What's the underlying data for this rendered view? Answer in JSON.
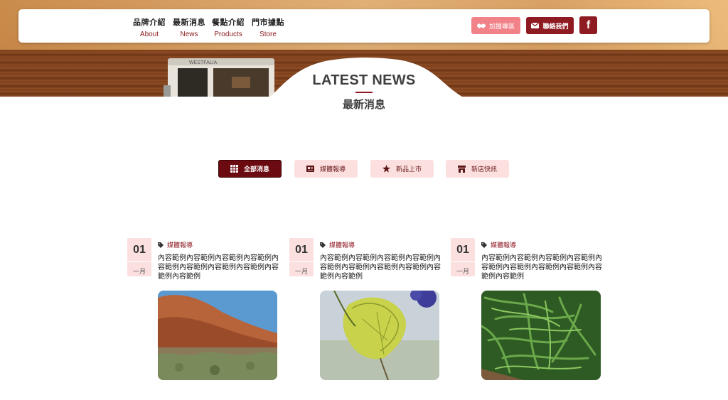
{
  "nav": {
    "items": [
      {
        "zh": "品牌介紹",
        "en": "About"
      },
      {
        "zh": "最新消息",
        "en": "News"
      },
      {
        "zh": "餐點介紹",
        "en": "Products"
      },
      {
        "zh": "門市據點",
        "en": "Store"
      }
    ],
    "join_label": "加盟專區",
    "contact_label": "聯絡我們",
    "facebook_label": "f"
  },
  "section": {
    "title_en": "LATEST NEWS",
    "title_zh": "最新消息"
  },
  "tabs": [
    {
      "label": "全部消息",
      "icon": "grid-icon",
      "active": true
    },
    {
      "label": "媒體報導",
      "icon": "newspaper-icon",
      "active": false
    },
    {
      "label": "新品上市",
      "icon": "star-icon",
      "active": false
    },
    {
      "label": "新店快訊",
      "icon": "store-icon",
      "active": false
    }
  ],
  "cards": [
    {
      "day": "01",
      "month": "一月",
      "category": "媒體報導",
      "text": "內容範例內容範例內容範例內容範例內容範例內容範例內容範例內容範例內容範例內容範例",
      "image": "desert-rock-photo"
    },
    {
      "day": "01",
      "month": "一月",
      "category": "媒體報導",
      "text": "內容範例內容範例內容範例內容範例內容範例內容範例內容範例內容範例內容範例內容範例",
      "image": "leaf-photo"
    },
    {
      "day": "01",
      "month": "一月",
      "category": "媒體報導",
      "text": "內容範例內容範例內容範例內容範例內容範例內容範例內容範例內容範例內容範例內容範例",
      "image": "green-beans-photo"
    }
  ],
  "colors": {
    "brand": "#8e1a22",
    "active_tab": "#6b0a10",
    "tab_bg": "#fce0e0",
    "join_button": "#f08288"
  }
}
